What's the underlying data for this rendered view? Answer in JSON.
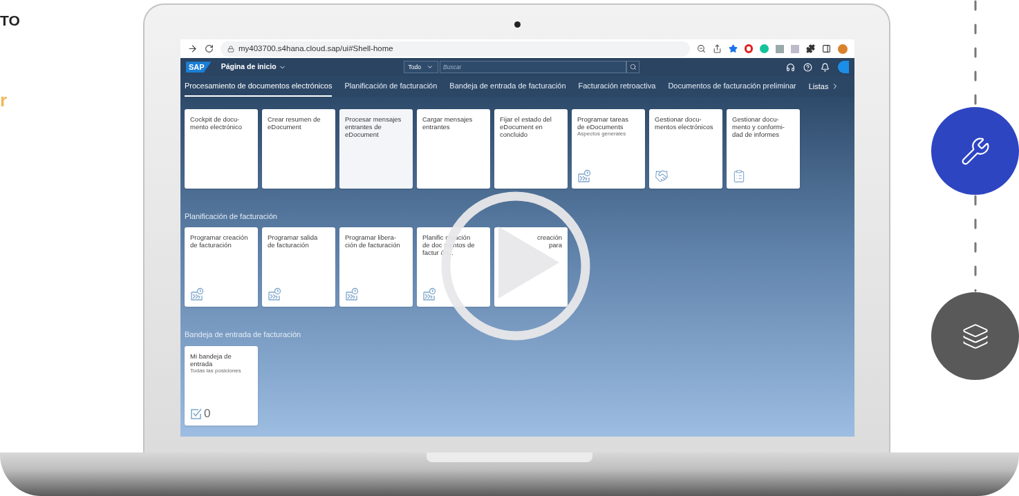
{
  "side_text": [
    {
      "kind": "heading",
      "text": "TO"
    },
    {
      "kind": "accent",
      "text": "r"
    }
  ],
  "browser": {
    "url": "my403700.s4hana.cloud.sap/ui#Shell-home"
  },
  "shell": {
    "logo": "SAP",
    "title": "Página de inicio",
    "search_scope": "Todo",
    "search_placeholder": "Buscar"
  },
  "tabs": [
    {
      "label": "Procesamiento de documentos electrónicos",
      "selected": true
    },
    {
      "label": "Planificación de facturación",
      "selected": false
    },
    {
      "label": "Bandeja de entrada de facturación",
      "selected": false
    },
    {
      "label": "Facturación retroactiva",
      "selected": false
    },
    {
      "label": "Documentos de facturación preliminar",
      "selected": false
    }
  ],
  "tabs_more": "Listas",
  "sections": [
    {
      "tiles": [
        {
          "title": "Cockpit de docu-\nmento electrónico",
          "kind": "plain"
        },
        {
          "title": "Crear resumen de\neDocument",
          "kind": "plain"
        },
        {
          "title": "Procesar mensajes\nentrantes de\neDocument",
          "kind": "plain",
          "hovered": true
        },
        {
          "title": "Cargar mensajes\nentrantes",
          "kind": "plain"
        },
        {
          "title": "Fijar el estado del\neDocument en\nconcluido",
          "kind": "plain"
        },
        {
          "title": "Programar tareas\nde eDocuments",
          "subtitle": "Aspectos generales",
          "kind": "schedule"
        },
        {
          "title": "Gestionar docu-\nmentos electrónicos",
          "kind": "handshake"
        },
        {
          "title": "Gestionar docu-\nmento y conformi-\ndad de informes",
          "kind": "report"
        }
      ]
    },
    {
      "title": "Planificación de facturación",
      "tiles": [
        {
          "title": "Programar creación\nde facturación",
          "kind": "schedule"
        },
        {
          "title": "Programar salida\nde facturación",
          "kind": "schedule"
        },
        {
          "title": "Programar libera-\nción de facturación",
          "kind": "schedule"
        },
        {
          "title": "Planific   creación\nde doc   mentos de\nfactur   ón...",
          "kind": "schedule"
        },
        {
          "title": "creación\npara",
          "kind": "plain",
          "partly_hidden": true
        }
      ]
    },
    {
      "title": "Bandeja de entrada de facturación",
      "tiles": [
        {
          "title": "Mi bandeja de\nentrada",
          "subtitle": "Todas las posiciones",
          "kind": "inbox",
          "count": "0"
        }
      ]
    }
  ],
  "side_icons": [
    {
      "kind": "wrench"
    },
    {
      "kind": "layers"
    }
  ]
}
